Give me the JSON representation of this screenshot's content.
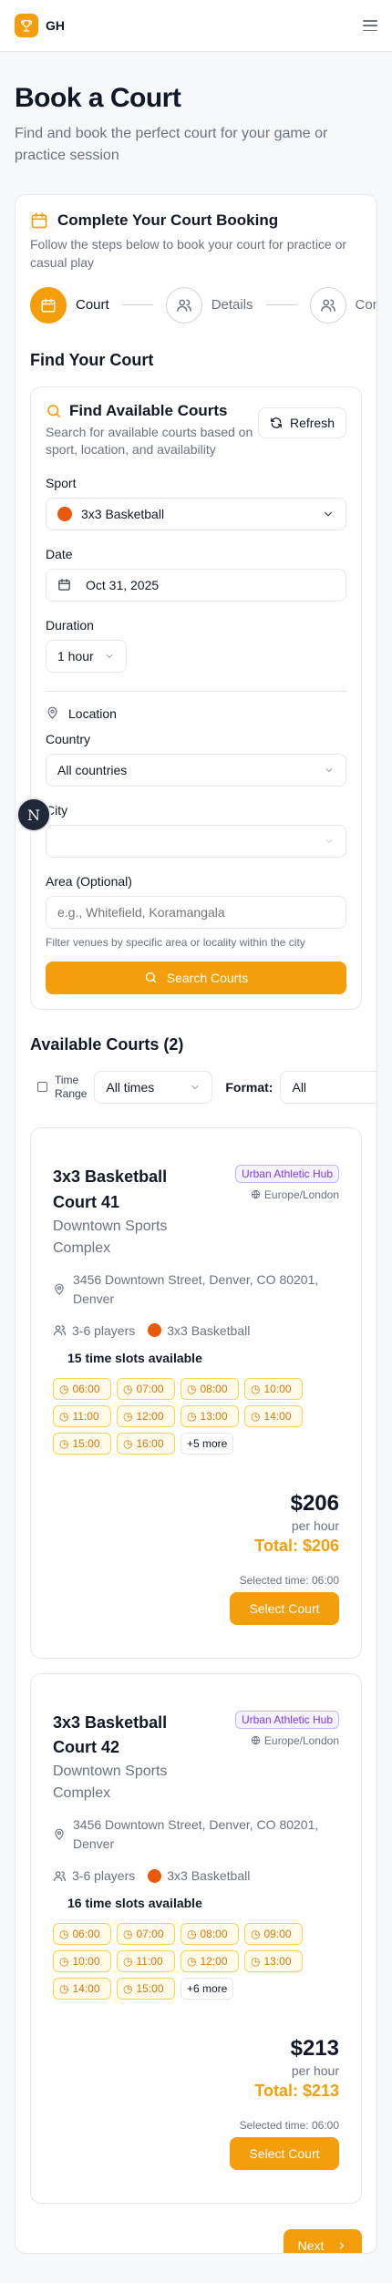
{
  "brand": {
    "name": "GH"
  },
  "hero": {
    "title": "Book a Court",
    "subtitle": "Find and book the perfect court for your game or practice session"
  },
  "booking": {
    "title": "Complete Your Court Booking",
    "subtitle": "Follow the steps below to book your court for practice or casual play",
    "steps": [
      {
        "label": "Court"
      },
      {
        "label": "Details"
      },
      {
        "label": "Contact"
      }
    ]
  },
  "find": {
    "section_title": "Find Your Court",
    "title": "Find Available Courts",
    "subtitle": "Search for available courts based on sport, location, and availability",
    "refresh_label": "Refresh",
    "sport_label": "Sport",
    "sport_value": "3x3 Basketball",
    "date_label": "Date",
    "date_value": "Oct 31, 2025",
    "duration_label": "Duration",
    "duration_value": "1 hour",
    "location_label": "Location",
    "country_label": "Country",
    "country_value": "All countries",
    "city_label": "City",
    "city_value": "",
    "area_label": "Area (Optional)",
    "area_placeholder": "e.g., Whitefield, Koramangala",
    "area_hint": "Filter venues by specific area or locality within the city",
    "search_label": "Search Courts"
  },
  "available": {
    "title": "Available Courts (2)",
    "time_range_label": "Time Range",
    "time_value": "All times",
    "format_label": "Format:",
    "format_value": "All"
  },
  "courts": [
    {
      "name": "3x3 Basketball Court 41",
      "venue": "Downtown Sports Complex",
      "badge": "Urban Athletic Hub",
      "timezone": "Europe/London",
      "address": "3456 Downtown Street, Denver, CO 80201, Denver",
      "players": "3-6 players",
      "sport": "3x3 Basketball",
      "slots_title": "15 time slots available",
      "slots": [
        "06:00",
        "07:00",
        "08:00",
        "10:00",
        "11:00",
        "12:00",
        "13:00",
        "14:00",
        "15:00",
        "16:00"
      ],
      "more": "+5 more",
      "price": "$206",
      "per": "per hour",
      "total": "Total: $206",
      "selected_time": "Selected time: 06:00",
      "select_label": "Select Court"
    },
    {
      "name": "3x3 Basketball Court 42",
      "venue": "Downtown Sports Complex",
      "badge": "Urban Athletic Hub",
      "timezone": "Europe/London",
      "address": "3456 Downtown Street, Denver, CO 80201, Denver",
      "players": "3-6 players",
      "sport": "3x3 Basketball",
      "slots_title": "16 time slots available",
      "slots": [
        "06:00",
        "07:00",
        "08:00",
        "09:00",
        "10:00",
        "11:00",
        "12:00",
        "13:00",
        "14:00",
        "15:00"
      ],
      "more": "+6 more",
      "price": "$213",
      "per": "per hour",
      "total": "Total: $213",
      "selected_time": "Selected time: 06:00",
      "select_label": "Select Court"
    }
  ],
  "next_label": "Next",
  "dev_badge": "N",
  "colors": {
    "accent": "#f59e0b",
    "badge_purple": "#7c3aed"
  }
}
